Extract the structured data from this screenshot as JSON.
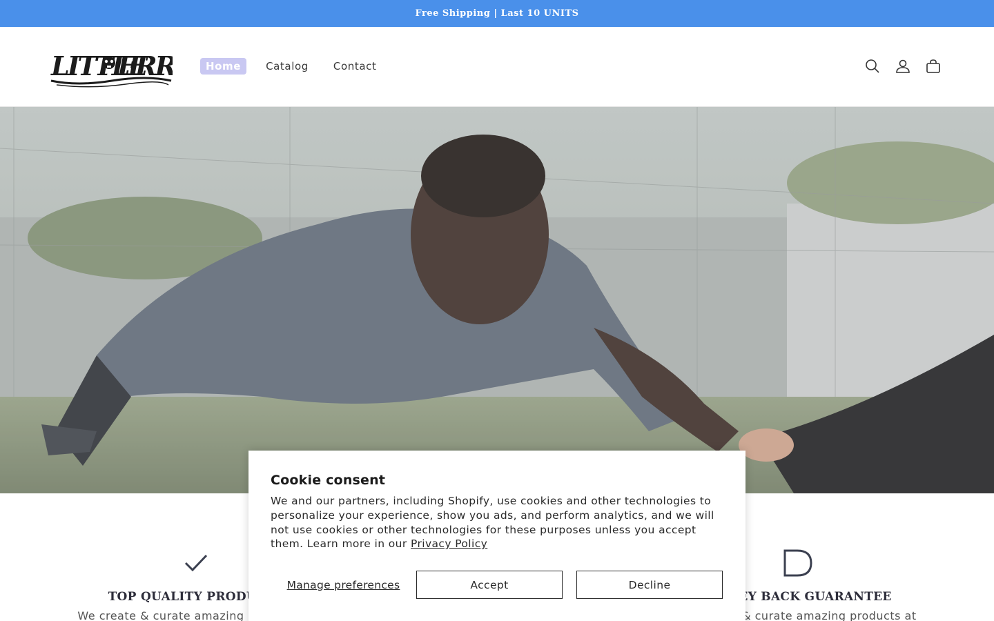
{
  "announcement": {
    "text": "Free Shipping | Last 10 UNITS",
    "bg": "#4a90ea"
  },
  "brand": {
    "logo_text": "LITTLE MERRY"
  },
  "nav": {
    "items": [
      {
        "label": "Home",
        "active": true
      },
      {
        "label": "Catalog",
        "active": false
      },
      {
        "label": "Contact",
        "active": false
      }
    ],
    "active_bg": "#c9c8f2"
  },
  "header_icons": [
    "search-icon",
    "account-icon",
    "cart-icon"
  ],
  "hero": {
    "image": "man doing push-up on grass, partner's hand reaching in"
  },
  "features": [
    {
      "icon": "check-icon",
      "title": "TOP QUALITY PRODUCTS",
      "text": "We create & curate amazing products at"
    },
    {
      "icon": "d-icon",
      "title": "MONEY BACK GUARANTEE",
      "text": "We create & curate amazing products at"
    }
  ],
  "cookie": {
    "title": "Cookie consent",
    "body": "We and our partners, including Shopify, use cookies and other technologies to personalize your experience, show you ads, and perform analytics, and we will not use cookies or other technologies for these purposes unless you accept them. Learn more in our ",
    "policy_link": "Privacy Policy",
    "manage_label": "Manage preferences",
    "accept_label": "Accept",
    "decline_label": "Decline"
  }
}
